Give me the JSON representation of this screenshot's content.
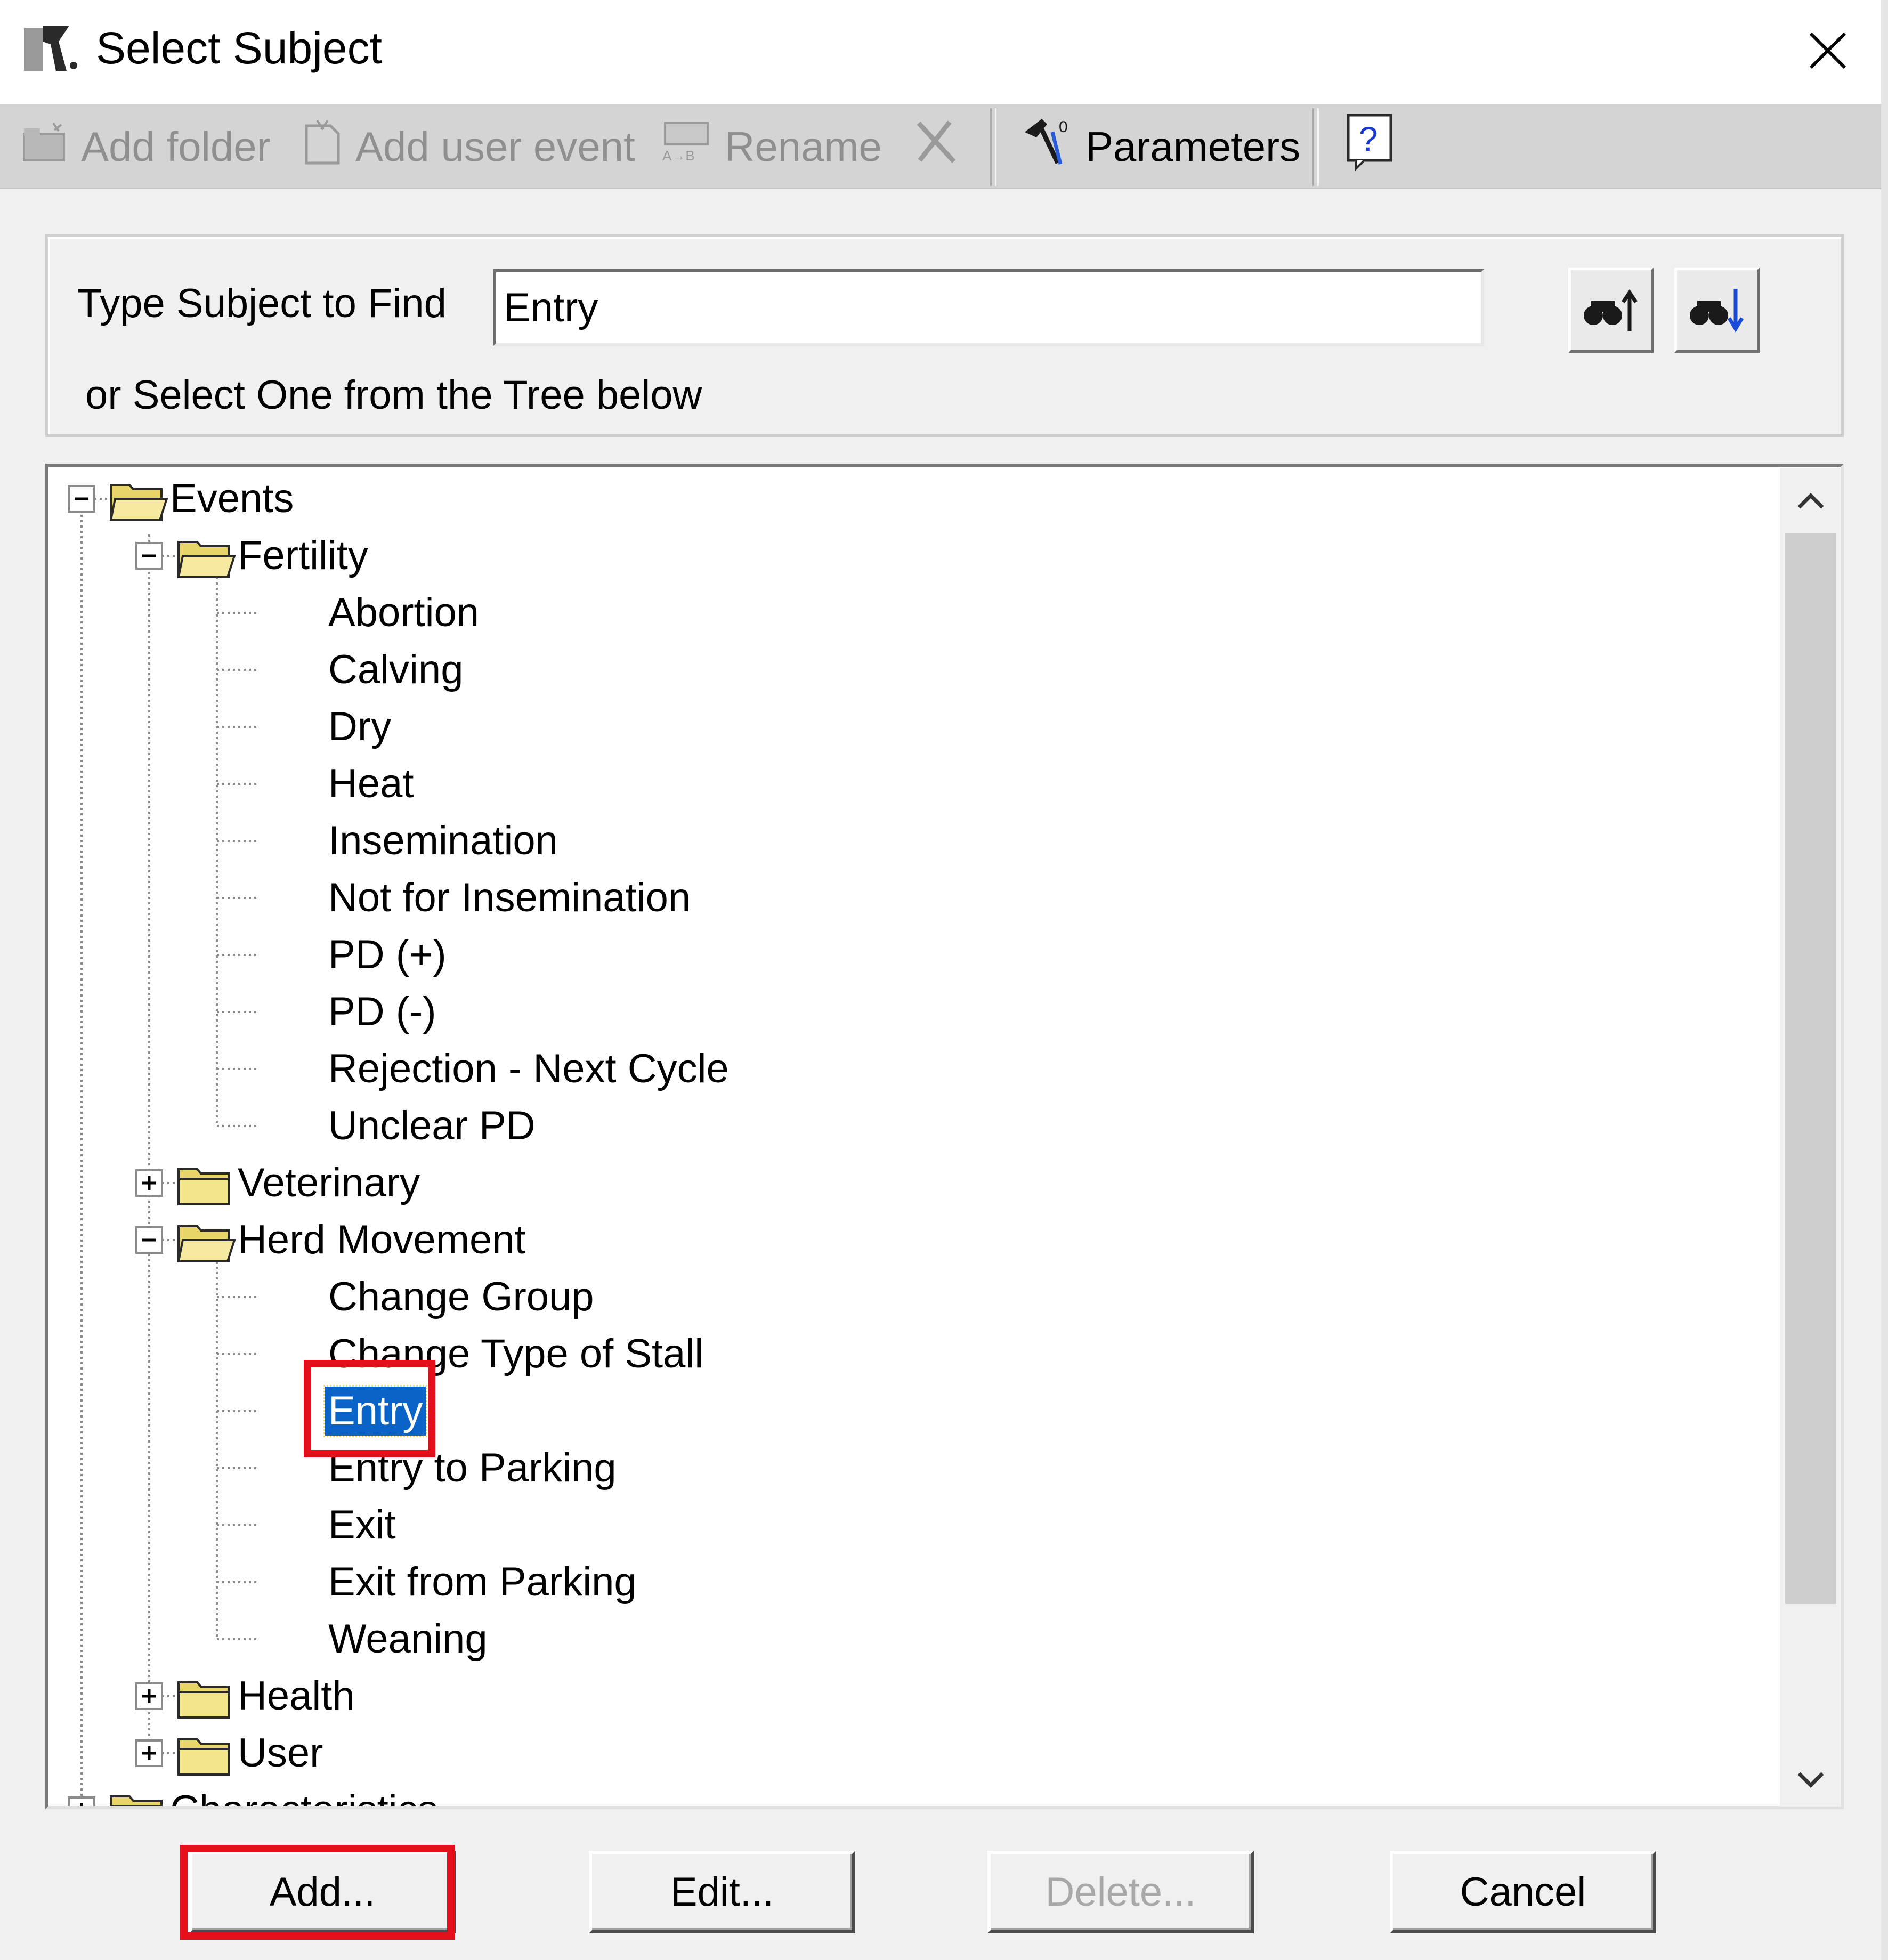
{
  "window": {
    "title": "Select Subject",
    "close_icon": "close-icon"
  },
  "toolbar": {
    "add_folder": "Add folder",
    "add_user_event": "Add user event",
    "rename": "Rename",
    "delete_icon": "x-icon",
    "parameters": "Parameters",
    "help_icon": "help-icon"
  },
  "find": {
    "label": "Type Subject to Find",
    "value": "Entry",
    "hint": "or Select One from the Tree below",
    "find_prev_icon": "binoculars-up-icon",
    "find_next_icon": "binoculars-down-icon"
  },
  "tree": {
    "nodes": [
      {
        "label": "Events",
        "level": 0,
        "type": "folder",
        "expanded": true
      },
      {
        "label": "Fertility",
        "level": 1,
        "type": "folder",
        "expanded": true
      },
      {
        "label": "Abortion",
        "level": 2,
        "type": "item"
      },
      {
        "label": "Calving",
        "level": 2,
        "type": "item"
      },
      {
        "label": "Dry",
        "level": 2,
        "type": "item"
      },
      {
        "label": "Heat",
        "level": 2,
        "type": "item"
      },
      {
        "label": "Insemination",
        "level": 2,
        "type": "item"
      },
      {
        "label": "Not for Insemination",
        "level": 2,
        "type": "item"
      },
      {
        "label": "PD (+)",
        "level": 2,
        "type": "item"
      },
      {
        "label": "PD (-)",
        "level": 2,
        "type": "item"
      },
      {
        "label": "Rejection - Next Cycle",
        "level": 2,
        "type": "item"
      },
      {
        "label": "Unclear PD",
        "level": 2,
        "type": "item"
      },
      {
        "label": "Veterinary",
        "level": 1,
        "type": "folder",
        "expanded": false
      },
      {
        "label": "Herd Movement",
        "level": 1,
        "type": "folder",
        "expanded": true
      },
      {
        "label": "Change Group",
        "level": 2,
        "type": "item"
      },
      {
        "label": "Change Type of Stall",
        "level": 2,
        "type": "item"
      },
      {
        "label": "Entry",
        "level": 2,
        "type": "item",
        "selected": true
      },
      {
        "label": "Entry to Parking",
        "level": 2,
        "type": "item"
      },
      {
        "label": "Exit",
        "level": 2,
        "type": "item"
      },
      {
        "label": "Exit from Parking",
        "level": 2,
        "type": "item"
      },
      {
        "label": "Weaning",
        "level": 2,
        "type": "item"
      },
      {
        "label": "Health",
        "level": 1,
        "type": "folder",
        "expanded": false
      },
      {
        "label": "User",
        "level": 1,
        "type": "folder",
        "expanded": false
      },
      {
        "label": "Characteristics",
        "level": 0,
        "type": "folder",
        "expanded": false
      }
    ]
  },
  "buttons": {
    "add": "Add...",
    "edit": "Edit...",
    "delete": "Delete...",
    "cancel": "Cancel"
  },
  "colors": {
    "highlight": "#e3101b",
    "selection": "#0a64c8",
    "folder": "#f3e58a"
  }
}
